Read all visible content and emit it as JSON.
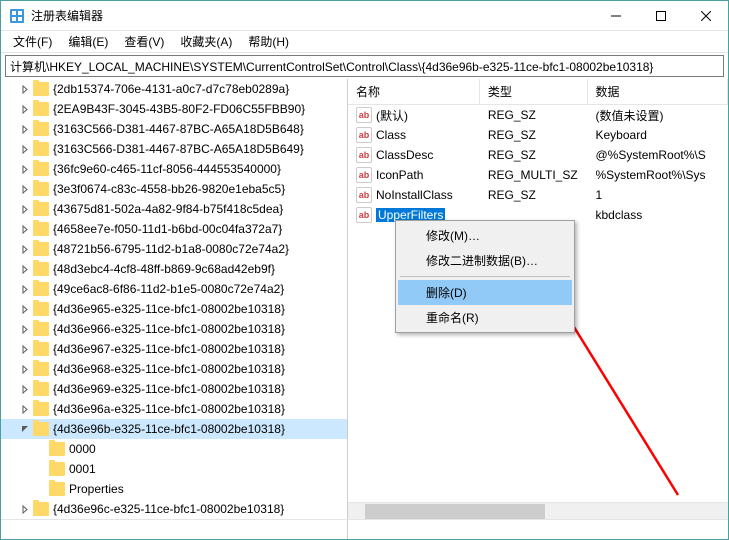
{
  "window": {
    "title": "注册表编辑器"
  },
  "menu": {
    "file": "文件(F)",
    "edit": "编辑(E)",
    "view": "查看(V)",
    "favorites": "收藏夹(A)",
    "help": "帮助(H)"
  },
  "address": "计算机\\HKEY_LOCAL_MACHINE\\SYSTEM\\CurrentControlSet\\Control\\Class\\{4d36e96b-e325-11ce-bfc1-08002be10318}",
  "tree": {
    "items": [
      {
        "name": "{2db15374-706e-4131-a0c7-d7c78eb0289a}",
        "indent": 1
      },
      {
        "name": "{2EA9B43F-3045-43B5-80F2-FD06C55FBB90}",
        "indent": 1
      },
      {
        "name": "{3163C566-D381-4467-87BC-A65A18D5B648}",
        "indent": 1
      },
      {
        "name": "{3163C566-D381-4467-87BC-A65A18D5B649}",
        "indent": 1
      },
      {
        "name": "{36fc9e60-c465-11cf-8056-444553540000}",
        "indent": 1
      },
      {
        "name": "{3e3f0674-c83c-4558-bb26-9820e1eba5c5}",
        "indent": 1
      },
      {
        "name": "{43675d81-502a-4a82-9f84-b75f418c5dea}",
        "indent": 1
      },
      {
        "name": "{4658ee7e-f050-11d1-b6bd-00c04fa372a7}",
        "indent": 1
      },
      {
        "name": "{48721b56-6795-11d2-b1a8-0080c72e74a2}",
        "indent": 1
      },
      {
        "name": "{48d3ebc4-4cf8-48ff-b869-9c68ad42eb9f}",
        "indent": 1
      },
      {
        "name": "{49ce6ac8-6f86-11d2-b1e5-0080c72e74a2}",
        "indent": 1
      },
      {
        "name": "{4d36e965-e325-11ce-bfc1-08002be10318}",
        "indent": 1
      },
      {
        "name": "{4d36e966-e325-11ce-bfc1-08002be10318}",
        "indent": 1
      },
      {
        "name": "{4d36e967-e325-11ce-bfc1-08002be10318}",
        "indent": 1
      },
      {
        "name": "{4d36e968-e325-11ce-bfc1-08002be10318}",
        "indent": 1
      },
      {
        "name": "{4d36e969-e325-11ce-bfc1-08002be10318}",
        "indent": 1
      },
      {
        "name": "{4d36e96a-e325-11ce-bfc1-08002be10318}",
        "indent": 1
      },
      {
        "name": "{4d36e96b-e325-11ce-bfc1-08002be10318}",
        "indent": 1,
        "selected": true,
        "expanded": true
      },
      {
        "name": "0000",
        "indent": 2,
        "leaf": true
      },
      {
        "name": "0001",
        "indent": 2,
        "leaf": true
      },
      {
        "name": "Properties",
        "indent": 2,
        "leaf": true
      },
      {
        "name": "{4d36e96c-e325-11ce-bfc1-08002be10318}",
        "indent": 1
      }
    ]
  },
  "list": {
    "headers": {
      "name": "名称",
      "type": "类型",
      "data": "数据"
    },
    "cols": {
      "name": 150,
      "type": 122,
      "data": 160
    },
    "rows": [
      {
        "name": "(默认)",
        "type": "REG_SZ",
        "data": "(数值未设置)"
      },
      {
        "name": "Class",
        "type": "REG_SZ",
        "data": "Keyboard"
      },
      {
        "name": "ClassDesc",
        "type": "REG_SZ",
        "data": "@%SystemRoot%\\S"
      },
      {
        "name": "IconPath",
        "type": "REG_MULTI_SZ",
        "data": "%SystemRoot%\\Sys"
      },
      {
        "name": "NoInstallClass",
        "type": "REG_SZ",
        "data": "1"
      },
      {
        "name": "UpperFilters",
        "type": "",
        "data": "kbdclass",
        "selected": true
      }
    ]
  },
  "context_menu": {
    "modify": "修改(M)…",
    "modify_binary": "修改二进制数据(B)…",
    "delete": "删除(D)",
    "rename": "重命名(R)"
  }
}
